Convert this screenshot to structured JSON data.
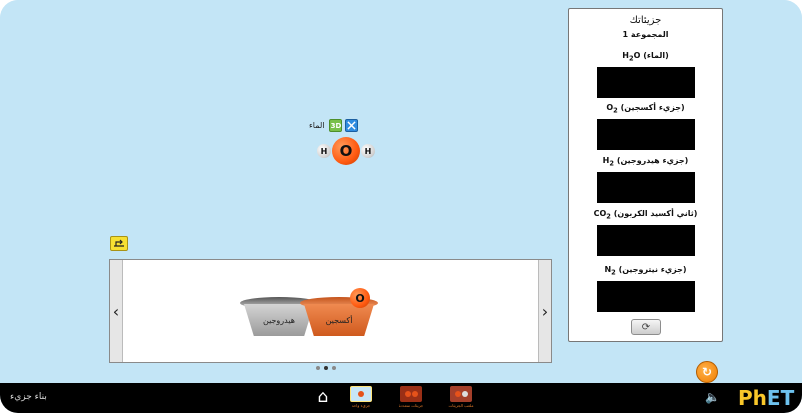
{
  "play_area": {
    "molecule": {
      "name": "الماء",
      "three_d_label": "3D",
      "atoms": {
        "hydrogen": "H",
        "oxygen": "O"
      }
    }
  },
  "kit": {
    "buckets": [
      {
        "label": "هيدروجين"
      },
      {
        "label": "أكسجين",
        "atom": "O"
      }
    ],
    "page_count": 3,
    "active_page": 1
  },
  "collection": {
    "title": "جزيئاتك",
    "group": "المجموعة 1",
    "goals": [
      {
        "formula": "H",
        "sub": "2",
        "rest": "O",
        "name": "(الماء)"
      },
      {
        "formula": "O",
        "sub": "2",
        "rest": "",
        "name": "(جزيء أكسجين)"
      },
      {
        "formula": "H",
        "sub": "2",
        "rest": "",
        "name": "(جزيء هيدروجين)"
      },
      {
        "formula": "CO",
        "sub": "2",
        "rest": "",
        "name": "(ثاني أكسيد الكربون)"
      },
      {
        "formula": "N",
        "sub": "2",
        "rest": "",
        "name": "(جزيء نيتروجين)"
      }
    ]
  },
  "nav": {
    "sim_title": "بناء جزيء",
    "screens": [
      {
        "label": "جزيء واحد"
      },
      {
        "label": "جزيئات متعددة"
      },
      {
        "label": "ملعب الجزيئات"
      }
    ],
    "logo_ph": "Ph",
    "logo_et": "ET"
  },
  "colors": {
    "background": "#c3e5f6",
    "oxygen": "#ff5a10",
    "accent": "#f07d00"
  }
}
